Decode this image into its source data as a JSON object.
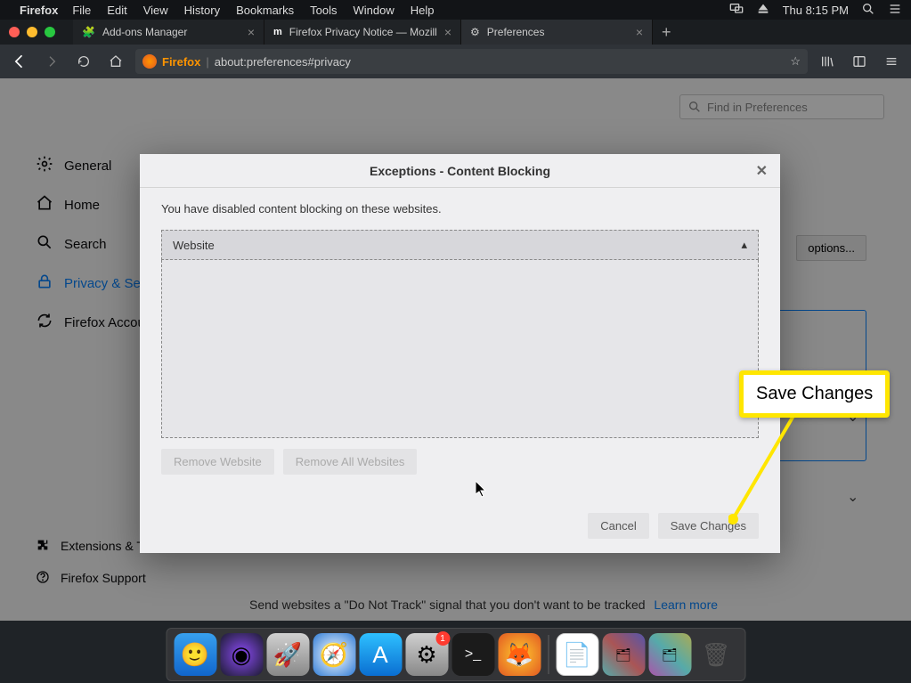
{
  "menubar": {
    "app": "Firefox",
    "items": [
      "File",
      "Edit",
      "View",
      "History",
      "Bookmarks",
      "Tools",
      "Window",
      "Help"
    ],
    "clock": "Thu 8:15 PM"
  },
  "tabs": {
    "items": [
      {
        "title": "Add-ons Manager",
        "icon": "puzzle"
      },
      {
        "title": "Firefox Privacy Notice — Mozill",
        "icon": "mozilla"
      },
      {
        "title": "Preferences",
        "icon": "gear",
        "active": true
      }
    ]
  },
  "urlbar": {
    "brand": "Firefox",
    "url": "about:preferences#privacy"
  },
  "prefs": {
    "search_placeholder": "Find in Preferences",
    "sidebar": {
      "items": [
        {
          "label": "General",
          "icon": "gear"
        },
        {
          "label": "Home",
          "icon": "home"
        },
        {
          "label": "Search",
          "icon": "search"
        },
        {
          "label": "Privacy & Security",
          "icon": "lock",
          "active": true
        },
        {
          "label": "Firefox Account",
          "icon": "sync"
        }
      ],
      "footer": [
        {
          "label": "Extensions & Themes",
          "icon": "puzzle"
        },
        {
          "label": "Firefox Support",
          "icon": "question"
        }
      ]
    },
    "options_btn": "options...",
    "dnt": {
      "text": "Send websites a \"Do Not Track\" signal that you don't want to be tracked",
      "link": "Learn more"
    }
  },
  "modal": {
    "title": "Exceptions - Content Blocking",
    "description": "You have disabled content blocking on these websites.",
    "column": "Website",
    "remove_one": "Remove Website",
    "remove_all": "Remove All Websites",
    "cancel": "Cancel",
    "save": "Save Changes"
  },
  "annotation": {
    "label": "Save Changes"
  },
  "dock": {
    "badge": "1"
  }
}
